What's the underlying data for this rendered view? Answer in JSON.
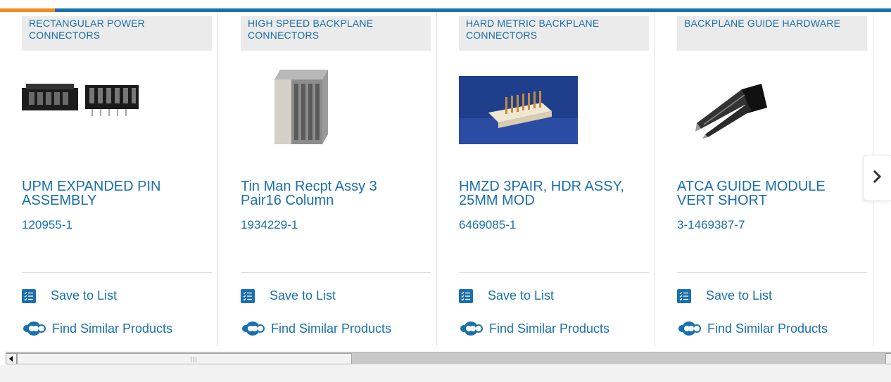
{
  "colors": {
    "accent": "#f28a1e",
    "brand_blue": "#1a6fae",
    "category_bg": "#ebebeb"
  },
  "icons": {
    "save": "checklist-icon",
    "similar": "gear-search-icon",
    "next": "chevron-right-icon"
  },
  "products": [
    {
      "category": "RECTANGULAR POWER CONNECTORS",
      "title": "UPM EXPANDED PIN ASSEMBLY",
      "part_number": "120955-1",
      "save_label": "Save to List",
      "similar_label": "Find Similar Products"
    },
    {
      "category": "HIGH SPEED BACKPLANE CONNECTORS",
      "title": "Tin Man Recpt Assy 3 Pair16 Column",
      "part_number": "1934229-1",
      "save_label": "Save to List",
      "similar_label": "Find Similar Products"
    },
    {
      "category": "HARD METRIC BACKPLANE CONNECTORS",
      "title": "HMZD 3PAIR, HDR ASSY, 25MM MOD",
      "part_number": "6469085-1",
      "save_label": "Save to List",
      "similar_label": "Find Similar Products"
    },
    {
      "category": "BACKPLANE GUIDE HARDWARE",
      "title": "ATCA GUIDE MODULE VERT SHORT",
      "part_number": "3-1469387-7",
      "save_label": "Save to List",
      "similar_label": "Find Similar Products"
    }
  ]
}
